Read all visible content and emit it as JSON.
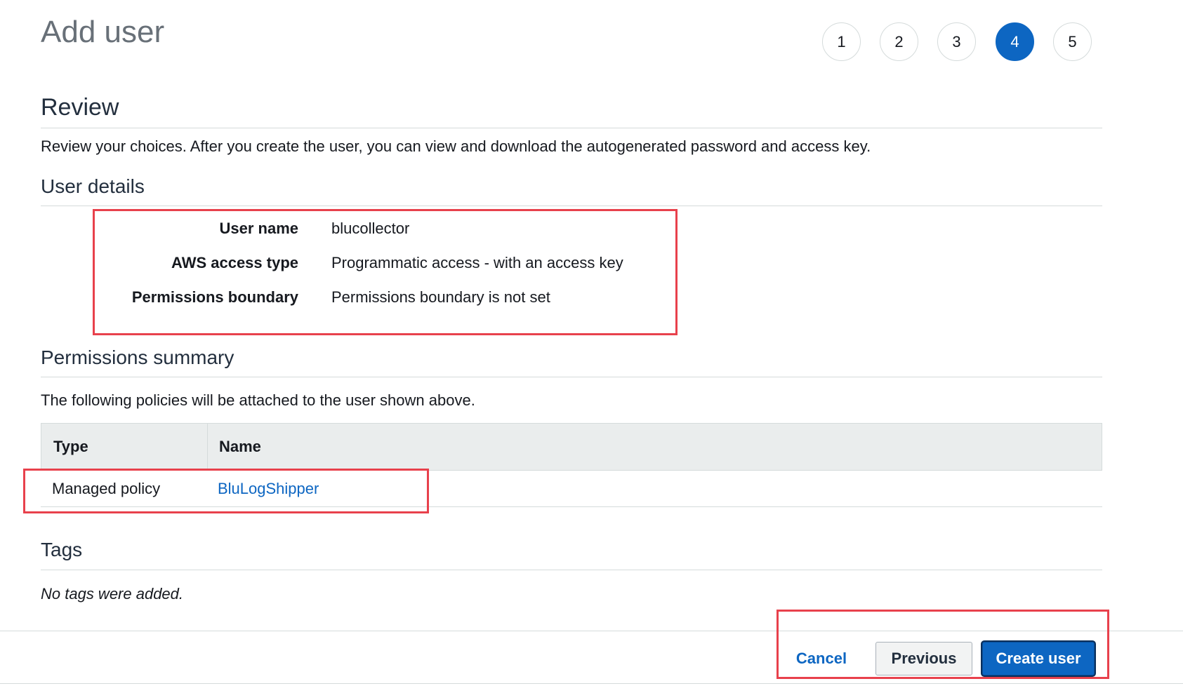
{
  "page": {
    "title": "Add user",
    "steps": [
      "1",
      "2",
      "3",
      "4",
      "5"
    ],
    "active_step": "4"
  },
  "review": {
    "title": "Review",
    "description": "Review your choices. After you create the user, you can view and download the autogenerated password and access key."
  },
  "user_details": {
    "title": "User details",
    "rows": [
      {
        "label": "User name",
        "value": "blucollector"
      },
      {
        "label": "AWS access type",
        "value": "Programmatic access - with an access key"
      },
      {
        "label": "Permissions boundary",
        "value": "Permissions boundary is not set"
      }
    ]
  },
  "permissions_summary": {
    "title": "Permissions summary",
    "description": "The following policies will be attached to the user shown above.",
    "columns": [
      "Type",
      "Name"
    ],
    "rows": [
      {
        "type": "Managed policy",
        "name": "BluLogShipper"
      }
    ]
  },
  "tags": {
    "title": "Tags",
    "empty_text": "No tags were added."
  },
  "footer": {
    "cancel_label": "Cancel",
    "previous_label": "Previous",
    "create_label": "Create user"
  },
  "colors": {
    "accent": "#0d66c2",
    "highlight": "#e8414c"
  }
}
